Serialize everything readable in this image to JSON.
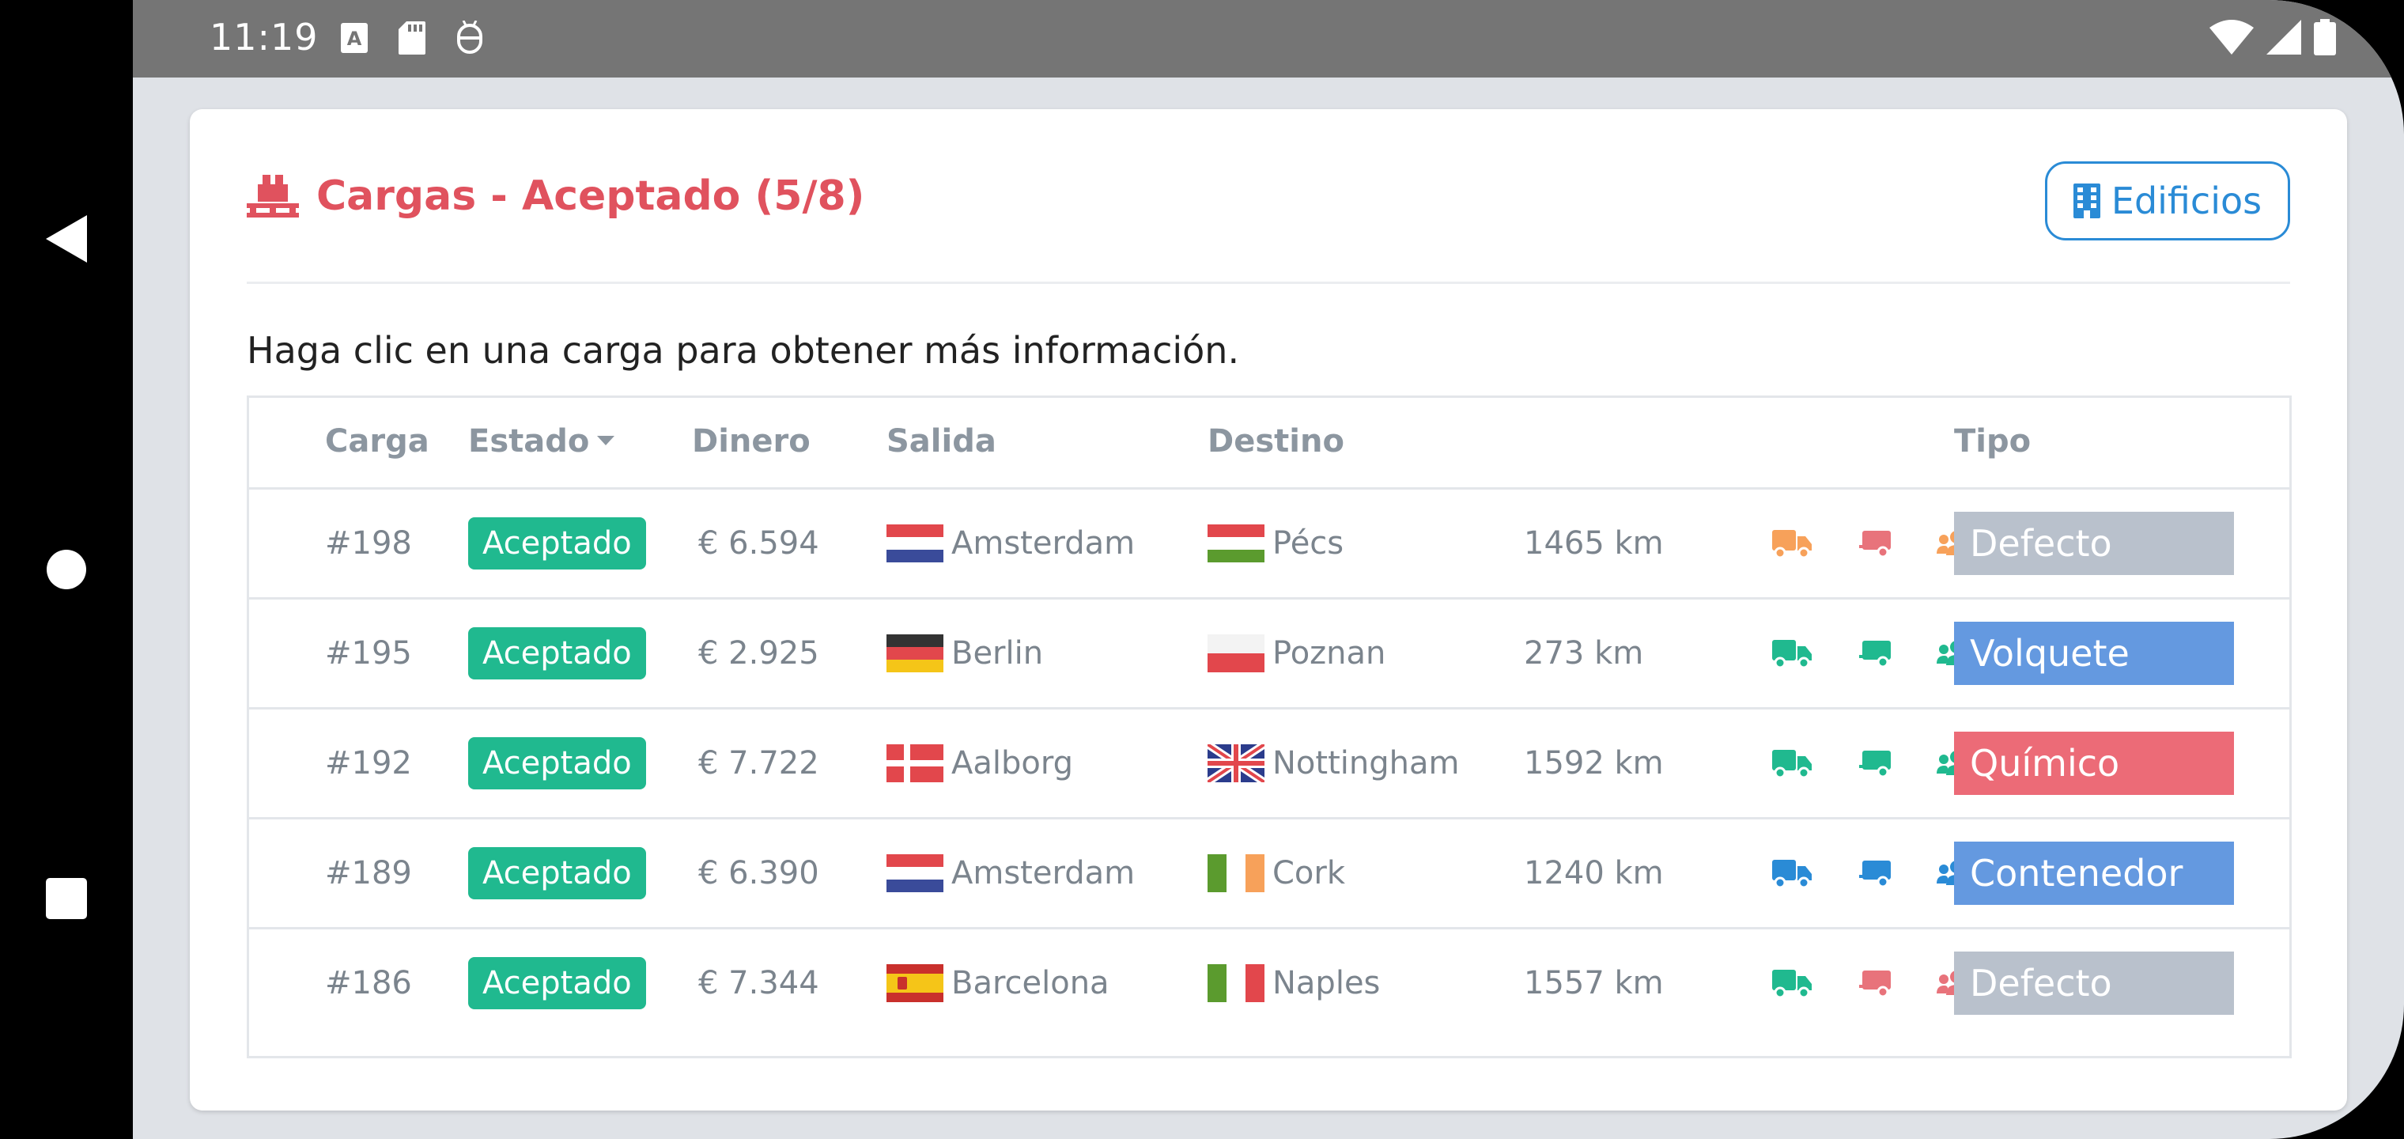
{
  "status_bar": {
    "time": "11:19"
  },
  "header": {
    "title": "Cargas - Aceptado (5/8)",
    "buildings_button": "Edificios"
  },
  "hint": "Haga clic en una carga para obtener más información.",
  "table": {
    "columns": {
      "carga": "Carga",
      "estado": "Estado",
      "dinero": "Dinero",
      "salida": "Salida",
      "destino": "Destino",
      "tipo": "Tipo"
    },
    "rows": [
      {
        "id": "#198",
        "estado": "Aceptado",
        "dinero": "€ 6.594",
        "salida": "Amsterdam",
        "salida_flag": "nl-flag",
        "destino": "Pécs",
        "destino_flag": "hu-flag",
        "distance": "1465 km",
        "truck_color": "#f7a15a",
        "trailer_color": "#e8737b",
        "crew_color": "#f7a15a",
        "tipo": "Defecto",
        "tipo_color": "#b9c1cc"
      },
      {
        "id": "#195",
        "estado": "Aceptado",
        "dinero": "€ 2.925",
        "salida": "Berlin",
        "salida_flag": "de-flag",
        "destino": "Poznan",
        "destino_flag": "pl-flag",
        "distance": "273 km",
        "truck_color": "#20b98f",
        "trailer_color": "#20b98f",
        "crew_color": "#20b98f",
        "tipo": "Volquete",
        "tipo_color": "#6499e0"
      },
      {
        "id": "#192",
        "estado": "Aceptado",
        "dinero": "€ 7.722",
        "salida": "Aalborg",
        "salida_flag": "dk-flag",
        "destino": "Nottingham",
        "destino_flag": "uk-flag",
        "distance": "1592 km",
        "truck_color": "#20b98f",
        "trailer_color": "#20b98f",
        "crew_color": "#20b98f",
        "tipo": "Químico",
        "tipo_color": "#ec6b77"
      },
      {
        "id": "#189",
        "estado": "Aceptado",
        "dinero": "€ 6.390",
        "salida": "Amsterdam",
        "salida_flag": "nl-flag",
        "destino": "Cork",
        "destino_flag": "ie-flag",
        "distance": "1240 km",
        "truck_color": "#2a8bd6",
        "trailer_color": "#2a8bd6",
        "crew_color": "#2a8bd6",
        "tipo": "Contenedor",
        "tipo_color": "#6499e0"
      },
      {
        "id": "#186",
        "estado": "Aceptado",
        "dinero": "€ 7.344",
        "salida": "Barcelona",
        "salida_flag": "es-flag",
        "destino": "Naples",
        "destino_flag": "it-flag",
        "distance": "1557 km",
        "truck_color": "#20b98f",
        "trailer_color": "#e8737b",
        "crew_color": "#e8737b",
        "tipo": "Defecto",
        "tipo_color": "#b9c1cc"
      }
    ]
  },
  "colors": {
    "accent_red": "#e0525e",
    "accent_blue": "#2a8bd6",
    "badge_green": "#20b98f"
  }
}
